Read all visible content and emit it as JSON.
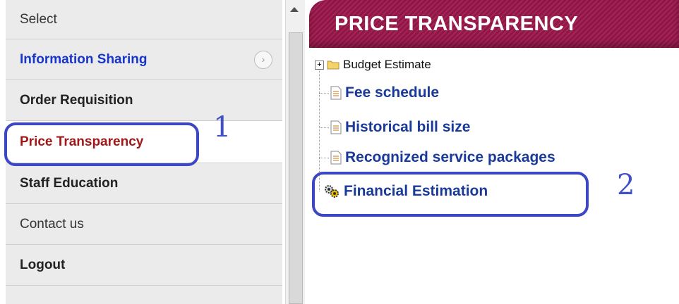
{
  "sidebar": {
    "items": [
      {
        "label": "Select"
      },
      {
        "label": "Information Sharing",
        "chevron": "›"
      },
      {
        "label": "Order Requisition"
      },
      {
        "label": "Price Transparency"
      },
      {
        "label": "Staff Education"
      },
      {
        "label": "Contact us"
      },
      {
        "label": "Logout"
      }
    ]
  },
  "annotations": {
    "one": "1",
    "two": "2"
  },
  "main": {
    "title": "PRICE TRANSPARENCY",
    "tree": [
      {
        "label": "Budget Estimate",
        "icon": "folder-icon",
        "expander": "+"
      },
      {
        "label": "Fee schedule",
        "icon": "document-icon"
      },
      {
        "label": "Historical bill size",
        "icon": "document-icon"
      },
      {
        "label": "Recognized service packages",
        "icon": "document-icon"
      },
      {
        "label": "Financial Estimation",
        "icon": "gears-icon"
      }
    ]
  },
  "colors": {
    "header_bg": "#9b1d50",
    "active_text": "#a01818",
    "link_blue": "#1a3a9a",
    "annotation": "#3d47c4"
  }
}
